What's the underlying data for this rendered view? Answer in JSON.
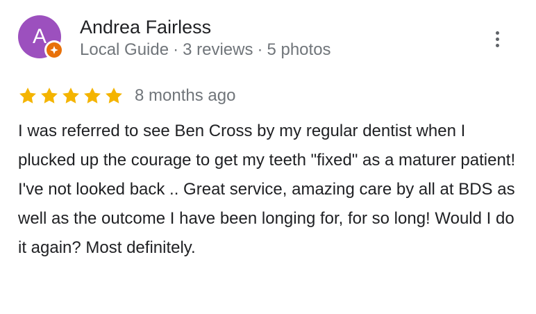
{
  "review": {
    "author": {
      "initial": "A",
      "name": "Andrea Fairless",
      "role": "Local Guide",
      "reviews": "3 reviews",
      "photos": "5 photos",
      "separator": "·"
    },
    "rating": 5,
    "rating_max": 5,
    "date": "8 months ago",
    "text": "I was referred to see Ben Cross by my regular dentist when I plucked up the courage to get my teeth \"fixed\" as a maturer patient! I've not looked back .. Great service, amazing care by all at BDS as well as the outcome I have been longing for, for so long! Would I do it again? Most definitely."
  },
  "colors": {
    "avatar_bg": "#9c50be",
    "badge_bg": "#e8710a",
    "star_filled": "#f4b400",
    "meta_text": "#70757a",
    "body_text": "#202124"
  },
  "icons": {
    "more": "more-vert-icon",
    "star": "star-icon",
    "badge": "local-guide-badge-icon"
  }
}
